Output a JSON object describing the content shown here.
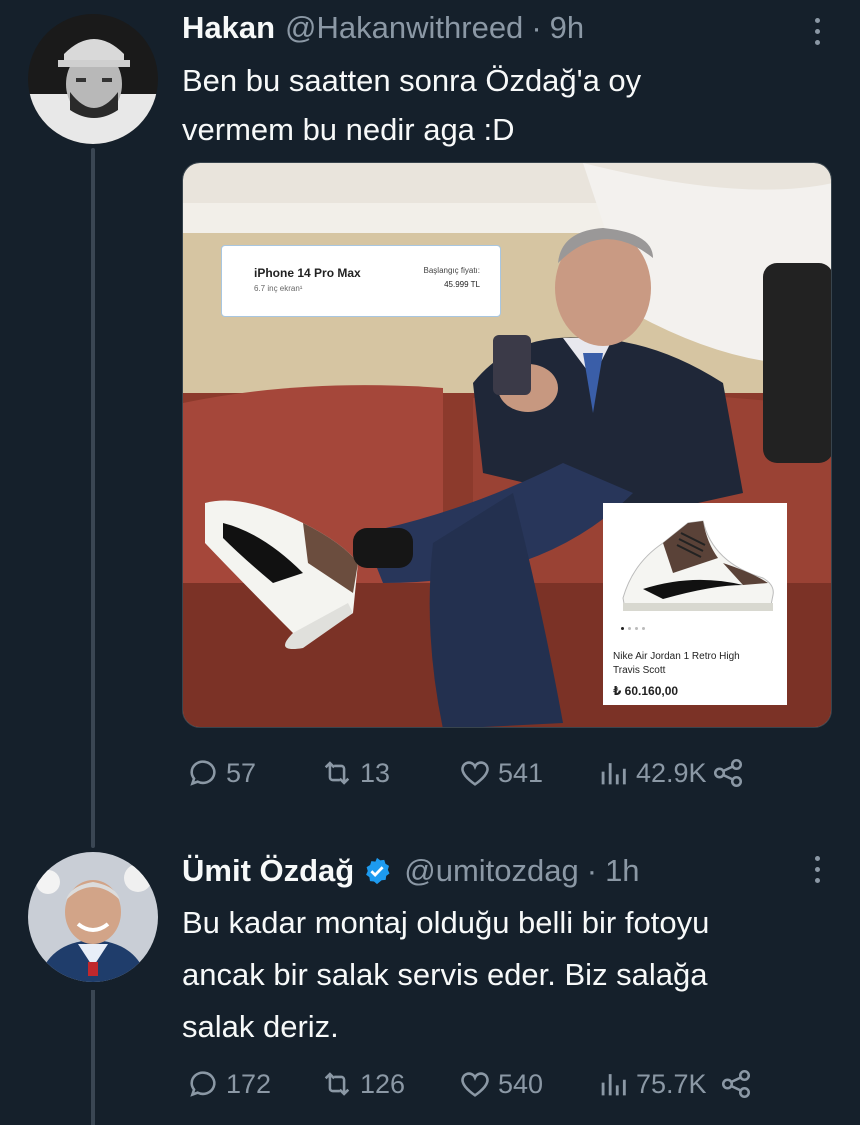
{
  "tweet1": {
    "name": "Hakan",
    "handle": "@Hakanwithreed",
    "separator": "·",
    "time": "9h",
    "text": "Ben bu saatten sonra Özdağ'a oy\nvermem bu nedir aga :D",
    "media": {
      "phone_card": {
        "title": "iPhone 14 Pro Max",
        "subtitle": "6.7 inç ekran¹",
        "price_label": "Başlangıç fiyatı:",
        "price": "45.999 TL"
      },
      "shoe_card": {
        "name_line1": "Nike Air Jordan 1 Retro High",
        "name_line2": "Travis Scott",
        "price": "₺ 60.160,00"
      }
    },
    "stats": {
      "replies": "57",
      "retweets": "13",
      "likes": "541",
      "views": "42.9K"
    }
  },
  "tweet2": {
    "name": "Ümit Özdağ",
    "handle": "@umitozdag",
    "separator": "·",
    "time": "1h",
    "text": "Bu kadar montaj olduğu belli bir fotoyu\nancak bir salak servis eder. Biz salağa\nsalak deriz.",
    "stats": {
      "replies": "172",
      "retweets": "126",
      "likes": "540",
      "views": "75.7K"
    }
  },
  "colors": {
    "background": "#15202b",
    "secondary_text": "#8b98a5",
    "verified_blue": "#1d9bf0",
    "thread_line": "#3a4653"
  },
  "icons": [
    "reply-icon",
    "retweet-icon",
    "like-icon",
    "views-icon",
    "share-icon",
    "more-icon",
    "verified-badge-icon"
  ]
}
